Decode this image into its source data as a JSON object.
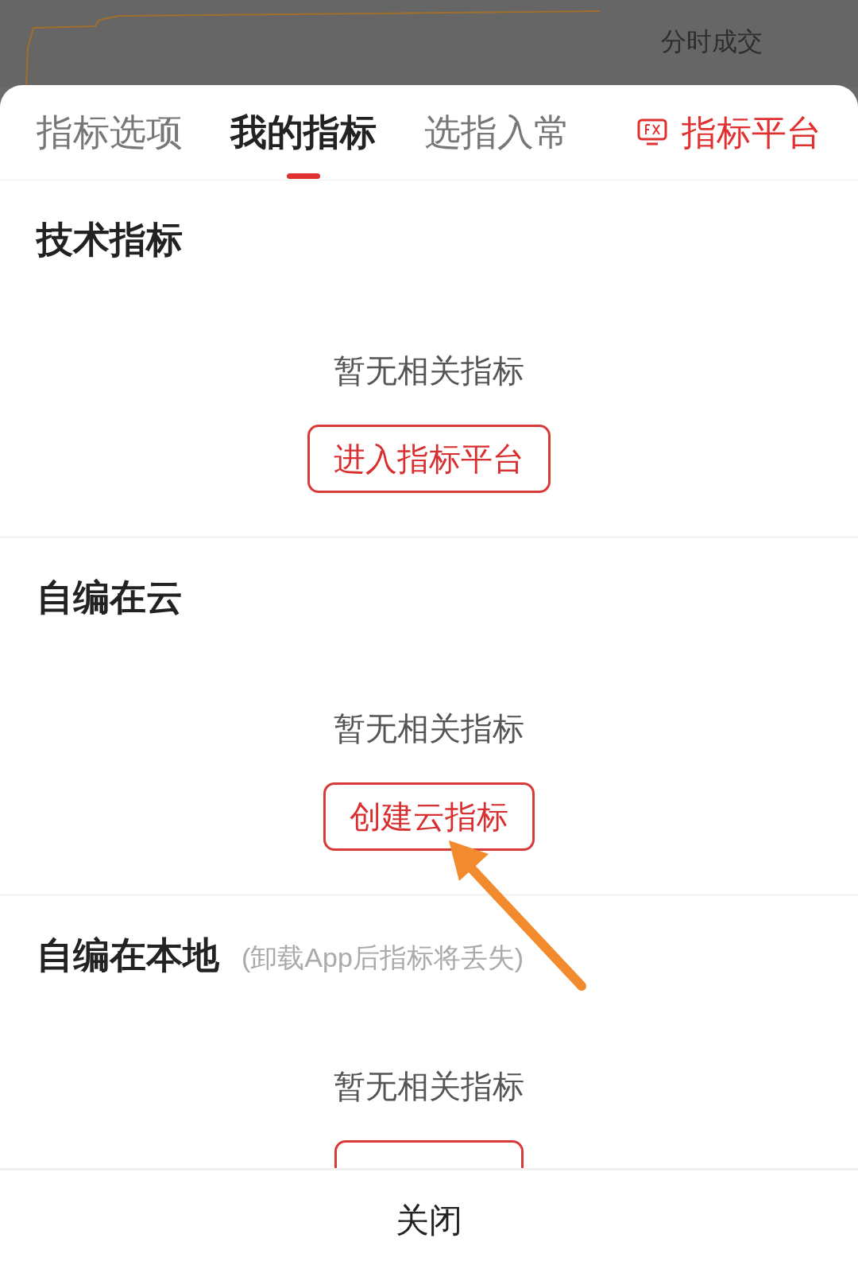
{
  "background": {
    "trades_title": "分时成交"
  },
  "tabs": [
    {
      "label": "指标选项",
      "selected": false
    },
    {
      "label": "我的指标",
      "selected": true
    },
    {
      "label": "选指入常",
      "selected": false
    }
  ],
  "platform_link": {
    "label": "指标平台"
  },
  "sections": [
    {
      "title": "技术指标",
      "empty_text": "暂无相关指标",
      "button": "进入指标平台"
    },
    {
      "title": "自编在云",
      "empty_text": "暂无相关指标",
      "button": "创建云指标"
    },
    {
      "title": "自编在本地",
      "note": "(卸载App后指标将丢失)",
      "empty_text": "暂无相关指标"
    }
  ],
  "close_button": "关闭"
}
